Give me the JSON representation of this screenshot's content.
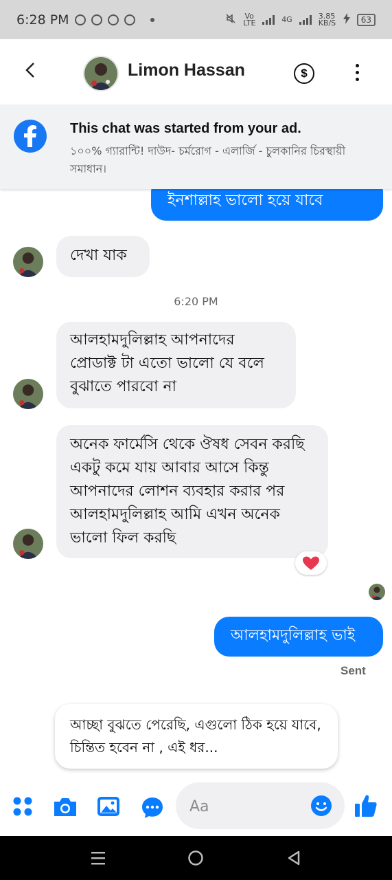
{
  "status_bar": {
    "time": "6:28 PM",
    "network": "Vo LTE",
    "network2": "4G",
    "speed": "3.85 KB/S",
    "battery": "63"
  },
  "header": {
    "contact_name": "Limon Hassan",
    "dollar_symbol": "$"
  },
  "banner": {
    "title": "This chat was started from your ad.",
    "subtitle": "১০০% গ্যারান্টি! দাউদ- চর্মরোগ - এলার্জি - চুলকানির চিরস্থায়ী সমাধান।"
  },
  "messages": [
    {
      "id": "m1",
      "direction": "out",
      "text": "ইনশাল্লাহ ভালো হয়ে যাবে"
    },
    {
      "id": "m2",
      "direction": "in",
      "text": "দেখা যাক"
    },
    {
      "id": "ts",
      "type": "timestamp",
      "text": "6:20 PM"
    },
    {
      "id": "m3",
      "direction": "in",
      "text": "আলহামদুলিল্লাহ আপনাদের প্রোডাক্ট টা এতো ভালো যে বলে বুঝাতে পারবো না"
    },
    {
      "id": "m4",
      "direction": "in",
      "text": "অনেক ফার্মেসি থেকে ঔষধ সেবন করছি একটু কমে যায় আবার আসে কিন্তু আপনাদের লোশন ব্যবহার করার পর আলহামদুলিল্লাহ আমি এখন অনেক ভালো ফিল করছি",
      "reaction": "heart"
    },
    {
      "id": "m5",
      "direction": "out",
      "text": "আলহামদুলিল্লাহ ভাই",
      "status": "Sent"
    }
  ],
  "suggestion": "আচ্ছা বুঝতে পেরেছি, এগুলো ঠিক হয়ে যাবে, চিন্তিত হবেন না , এই ধর...",
  "composer": {
    "placeholder": "Aa",
    "icons": [
      "menu-dots-icon",
      "camera-icon",
      "gallery-icon",
      "chat-bubble-icon",
      "emoji-icon",
      "thumbs-up-icon"
    ]
  },
  "colors": {
    "accent": "#0a7cff",
    "incoming_bubble": "#f0f0f2",
    "facebook_blue": "#1877f2",
    "reaction_heart": "#e8384f"
  }
}
